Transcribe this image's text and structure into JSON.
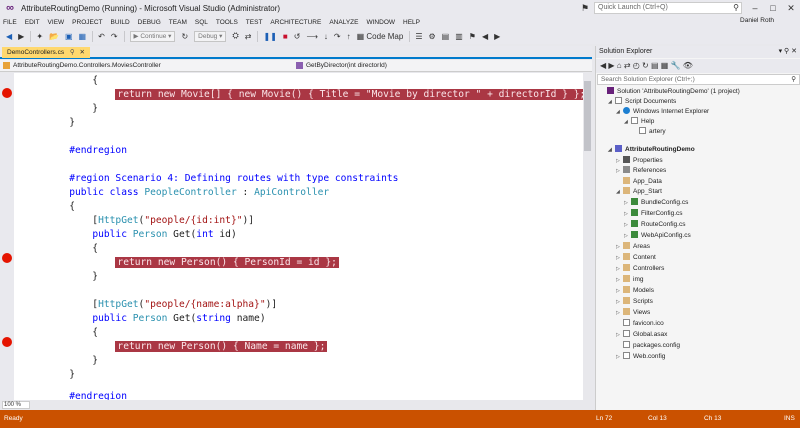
{
  "window": {
    "title": "AttributeRoutingDemo (Running) - Microsoft Visual Studio (Administrator)",
    "quick_launch_placeholder": "Quick Launch (Ctrl+Q)",
    "user_name": "Daniel Roth"
  },
  "menu": [
    "FILE",
    "EDIT",
    "VIEW",
    "PROJECT",
    "BUILD",
    "DEBUG",
    "TEAM",
    "SQL",
    "TOOLS",
    "TEST",
    "ARCHITECTURE",
    "ANALYZE",
    "WINDOW",
    "HELP"
  ],
  "toolbar": {
    "continue_label": "Continue",
    "config_label": "Debug",
    "code_map_label": "Code Map"
  },
  "editor": {
    "tab_label": "DemoControllers.cs",
    "nav_type": "AttributeRoutingDemo.Controllers.MoviesController",
    "nav_member": "GetByDirector(int directorId)",
    "zoom_level": "100 %",
    "lines": [
      "            {",
      "                return new Movie[] { new Movie() { Title = \"Movie by director \" + directorId } };",
      "            }",
      "        }",
      "",
      "        #endregion",
      "",
      "        #region Scenario 4: Defining routes with type constraints",
      "        public class PeopleController : ApiController",
      "        {",
      "            [HttpGet(\"people/{id:int}\")]",
      "            public Person Get(int id)",
      "            {",
      "                return new Person() { PersonId = id };",
      "            }",
      "",
      "            [HttpGet(\"people/{name:alpha}\")]",
      "            public Person Get(string name)",
      "            {",
      "                return new Person() { Name = name };",
      "            }",
      "        }",
      "",
      "        #endregion"
    ]
  },
  "solution_explorer": {
    "title": "Solution Explorer",
    "search_placeholder": "Search Solution Explorer (Ctrl+;)",
    "items": [
      {
        "label": "Solution 'AttributeRoutingDemo' (1 project)",
        "icon": "sol",
        "arrow": ""
      },
      {
        "label": "Script Documents",
        "icon": "file",
        "arrow": "◢"
      },
      {
        "label": "Windows Internet Explorer",
        "icon": "globe",
        "arrow": "◢"
      },
      {
        "label": "Help",
        "icon": "file",
        "arrow": "◢"
      },
      {
        "label": "artery",
        "icon": "file",
        "arrow": ""
      },
      {
        "label": "AttributeRoutingDemo",
        "icon": "proj",
        "arrow": "◢"
      },
      {
        "label": "Properties",
        "icon": "prop",
        "arrow": "▷"
      },
      {
        "label": "References",
        "icon": "ref",
        "arrow": "▷"
      },
      {
        "label": "App_Data",
        "icon": "folder",
        "arrow": ""
      },
      {
        "label": "App_Start",
        "icon": "folder",
        "arrow": "◢"
      },
      {
        "label": "BundleConfig.cs",
        "icon": "cs",
        "arrow": "▷"
      },
      {
        "label": "FilterConfig.cs",
        "icon": "cs",
        "arrow": "▷"
      },
      {
        "label": "RouteConfig.cs",
        "icon": "cs",
        "arrow": "▷"
      },
      {
        "label": "WebApiConfig.cs",
        "icon": "cs",
        "arrow": "▷"
      },
      {
        "label": "Areas",
        "icon": "folder",
        "arrow": "▷"
      },
      {
        "label": "Content",
        "icon": "folder",
        "arrow": "▷"
      },
      {
        "label": "Controllers",
        "icon": "folder",
        "arrow": "▷"
      },
      {
        "label": "img",
        "icon": "folder",
        "arrow": "▷"
      },
      {
        "label": "Models",
        "icon": "folder",
        "arrow": "▷"
      },
      {
        "label": "Scripts",
        "icon": "folder",
        "arrow": "▷"
      },
      {
        "label": "Views",
        "icon": "folder",
        "arrow": "▷"
      },
      {
        "label": "favicon.ico",
        "icon": "file",
        "arrow": ""
      },
      {
        "label": "Global.asax",
        "icon": "file",
        "arrow": "▷"
      },
      {
        "label": "packages.config",
        "icon": "file",
        "arrow": ""
      },
      {
        "label": "Web.config",
        "icon": "file",
        "arrow": "▷"
      }
    ]
  },
  "status": {
    "ready": "Ready",
    "line": "Ln 72",
    "col": "Col 13",
    "ch": "Ch 13",
    "ins": "INS"
  },
  "colors": {
    "status_bar": "#ca5100",
    "breakpoint": "#e51400",
    "breakpoint_line": "#aa3744",
    "keyword": "#0000ff",
    "type": "#2b91af",
    "string": "#a31515"
  }
}
